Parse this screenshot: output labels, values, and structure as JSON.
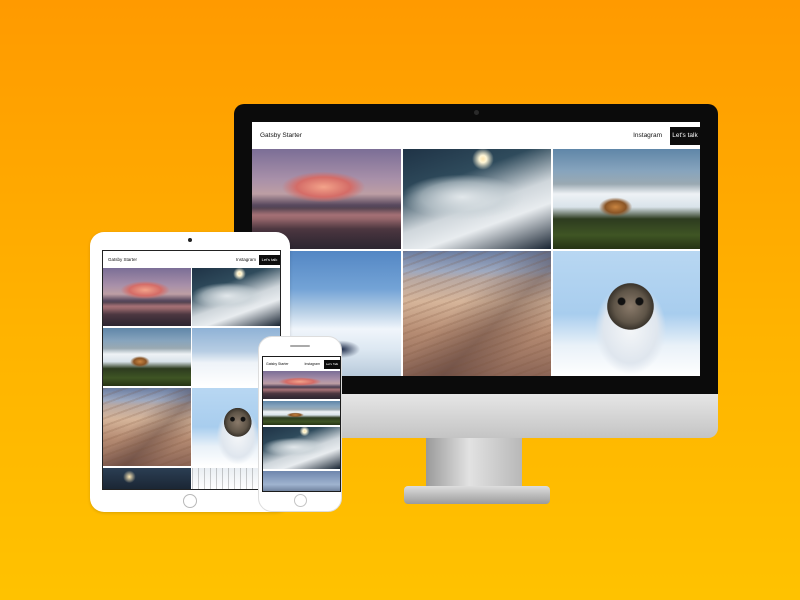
{
  "site": {
    "brand": "Gatsby Starter",
    "nav_link": "Instagram",
    "cta": "Let's talk"
  },
  "phone_site": {
    "brand": "Gatsby Starter",
    "nav_link": "Instagram",
    "cta": "Let's Talk"
  },
  "photos": {
    "imac": [
      "photo-mountain",
      "photo-snow-storm",
      "photo-castle-fog",
      "photo-skier",
      "photo-dunes",
      "photo-seal"
    ],
    "ipad": [
      "photo-mountain",
      "photo-snow-storm",
      "photo-castle-fog",
      "photo-snow-village",
      "photo-dunes",
      "photo-seal",
      "photo-dark-forest",
      "photo-bare-trees"
    ],
    "iphone": [
      "photo-mountain",
      "photo-castle-fog",
      "photo-snow-storm",
      "photo-sunset-sea"
    ]
  },
  "colors": {
    "background_top": "#ff9a00",
    "background_bottom": "#ffc200",
    "cta_background": "#0d0d0d"
  }
}
